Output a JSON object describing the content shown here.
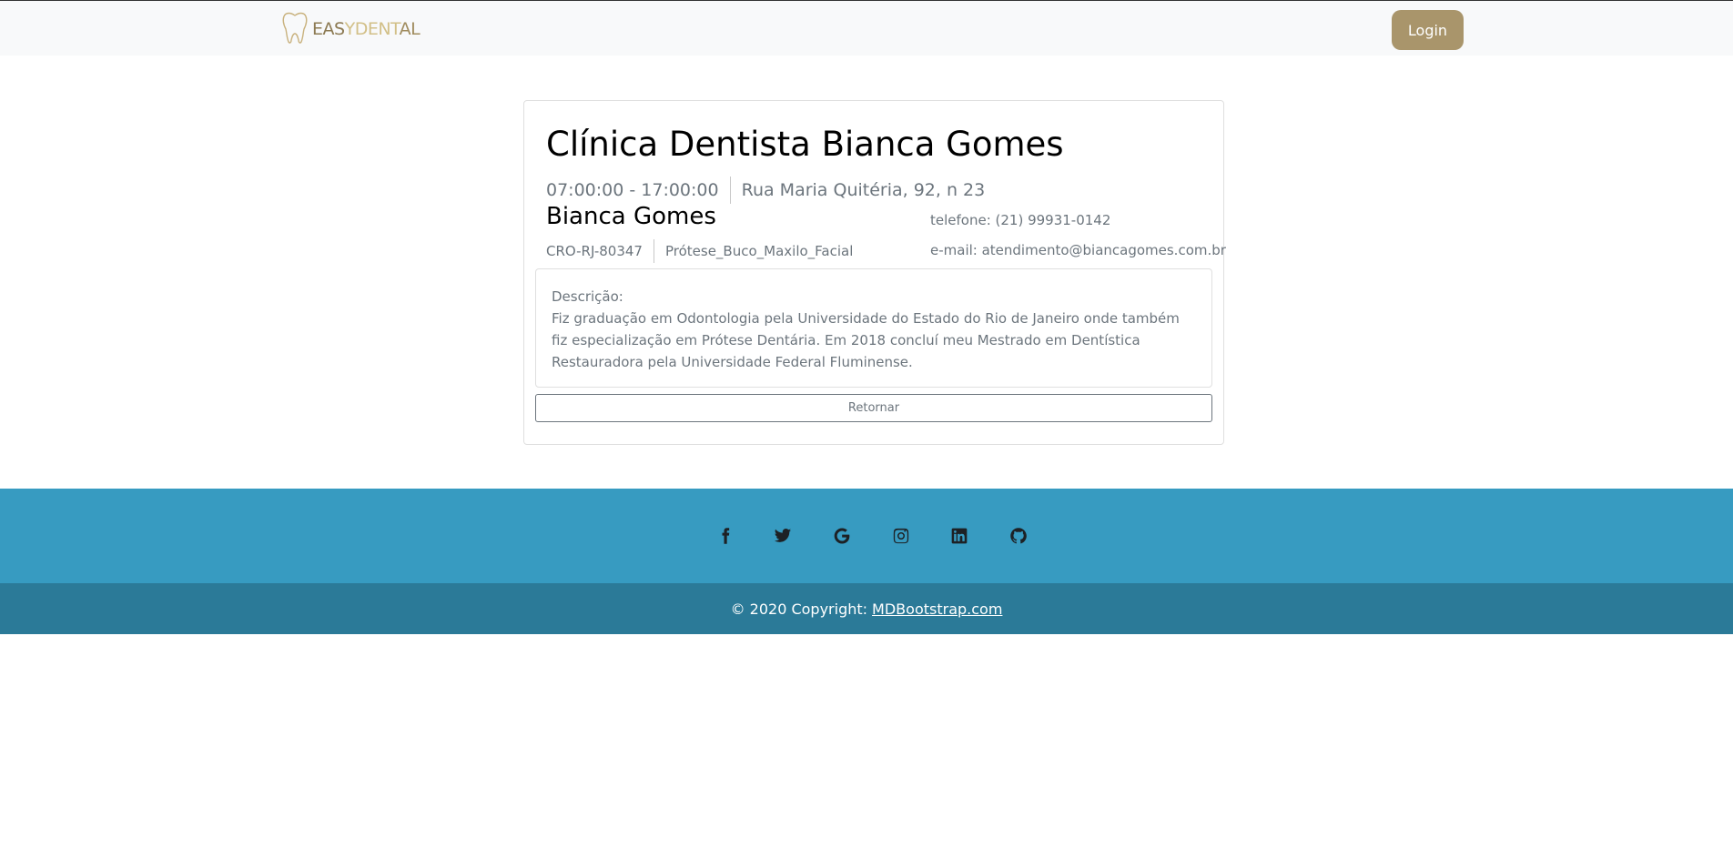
{
  "navbar": {
    "brand_text_1": "EAS",
    "brand_text_2": "Y",
    "brand_text_3": "DENT",
    "brand_text_4": "AL",
    "brand_icon": "tooth-icon",
    "login_label": "Login",
    "colors": {
      "background": "#f8f9fa",
      "login_button": "#a9956b",
      "brand": "#a89468"
    }
  },
  "clinic": {
    "title": "Clínica Dentista Bianca Gomes",
    "hours": "07:00:00 - 17:00:00",
    "address": "Rua Maria Quitéria, 92, n 23",
    "dentist_name": "Bianca Gomes",
    "cro": "CRO-RJ-80347",
    "specialty": "Prótese_Buco_Maxilo_Facial",
    "phone": "telefone: (21) 99931-0142",
    "email": "e-mail: atendimento@biancagomes.com.br",
    "description_label": "Descrição:",
    "description": "Fiz graduação em Odontologia pela Universidade do Estado do Rio de Janeiro onde também fiz especialização em Prótese Dentária. Em 2018 concluí meu Mestrado em Dentística Restauradora pela Universidade Federal Fluminense.",
    "return_label": "Retornar"
  },
  "footer": {
    "social_icons": [
      "facebook-icon",
      "twitter-icon",
      "google-icon",
      "instagram-icon",
      "linkedin-icon",
      "github-icon"
    ],
    "copyright_prefix": "© 2020 Copyright:",
    "copyright_link": "MDBootstrap.com",
    "colors": {
      "social_bar": "#379bc1",
      "copyright_bar": "#2b7a98"
    }
  }
}
